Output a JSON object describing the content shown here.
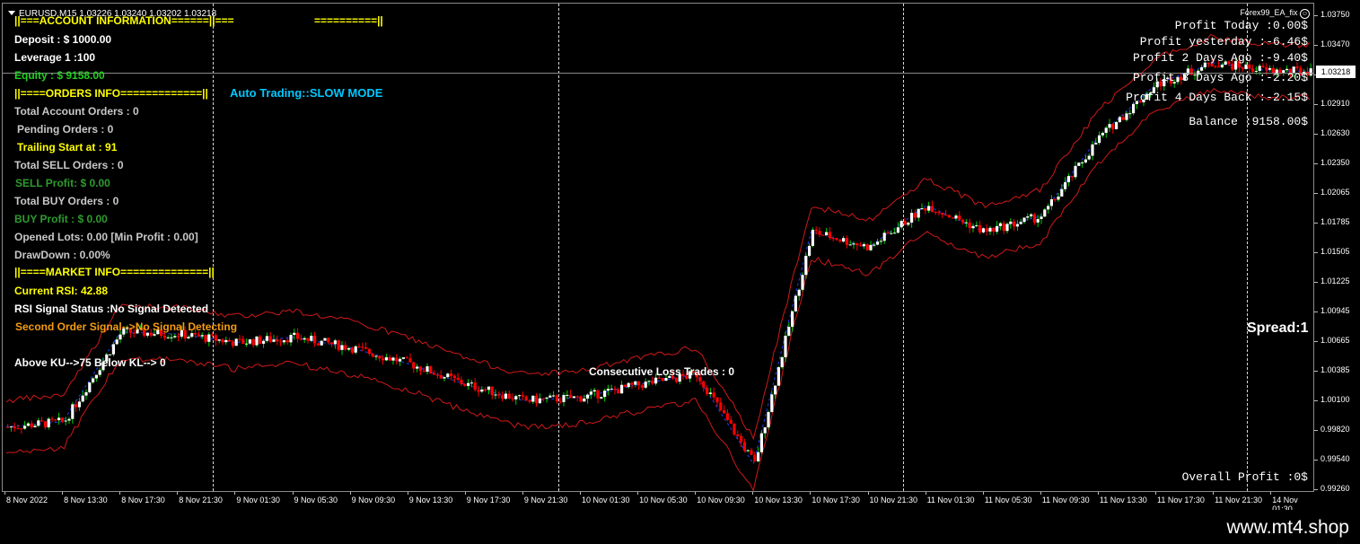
{
  "window": {
    "title": "EURUSD,M15  1.03226 1.03240 1.03202 1.03218",
    "ea_name": "Forex99_EA_fix",
    "smile_glyph": "☺"
  },
  "panel": {
    "account_header": "||===ACCOUNT INFORMATION======||===",
    "header_tail": "==========||",
    "deposit": "Deposit : $ 1000.00",
    "leverage": "Leverage 1 :100",
    "equity": "Equity : $ 9158.00",
    "orders_header": "||====ORDERS INFO=============||",
    "auto_trading": "Auto Trading::SLOW MODE",
    "total_account_orders": "Total Account Orders : 0",
    "pending_orders": "Pending Orders :  0",
    "trailing_start": "Trailing Start at :  91",
    "total_sell_orders": "Total SELL Orders :  0",
    "sell_profit": "SELL Profit: $ 0.00",
    "total_buy_orders": "Total BUY Orders :  0",
    "buy_profit": "BUY Profit : $ 0.00",
    "opened_lots": "Opened Lots: 0.00   [Min Profit :  0.00]",
    "drawdown": "DrawDown : 0.00%",
    "market_header": "||====MARKET INFO==============||",
    "current_rsi": "Current RSI:  42.88",
    "rsi_signal": "RSI Signal Status :No Signal  Detected",
    "second_order": "Second Order Signal-->No Signal Detecting",
    "above_below": "Above KU-->75 Below KL--> 0",
    "consecutive_loss": "Consecutive Loss Trades :  0",
    "spread": "Spread:1"
  },
  "profit_stats": {
    "today": "Profit Today :0.00$",
    "yesterday": "Profit yesterday :-6.46$",
    "two_days": "Profit 2 Days Ago :-9.40$",
    "three_days": "Profit 3 Days Ago :-2.20$",
    "four_days": "Profit 4 Days Back :-2.15$",
    "balance": "Balance :9158.00$",
    "overall": "Overall Profit :0$"
  },
  "price_axis": {
    "labels": [
      "1.03750",
      "1.03470",
      "1.03190",
      "1.02910",
      "1.02630",
      "1.02350",
      "1.02065",
      "1.01785",
      "1.01505",
      "1.01225",
      "1.00945",
      "1.00665",
      "1.00385",
      "1.00100",
      "0.99820",
      "0.99540",
      "0.99260"
    ],
    "current_price": "1.03218"
  },
  "time_axis": {
    "labels": [
      "8 Nov 2022",
      "8 Nov 13:30",
      "8 Nov 17:30",
      "8 Nov 21:30",
      "9 Nov 01:30",
      "9 Nov 05:30",
      "9 Nov 09:30",
      "9 Nov 13:30",
      "9 Nov 17:30",
      "9 Nov 21:30",
      "10 Nov 01:30",
      "10 Nov 05:30",
      "10 Nov 09:30",
      "10 Nov 13:30",
      "10 Nov 17:30",
      "10 Nov 21:30",
      "11 Nov 01:30",
      "11 Nov 05:30",
      "11 Nov 09:30",
      "11 Nov 13:30",
      "11 Nov 17:30",
      "11 Nov 21:30",
      "14 Nov 01:30"
    ]
  },
  "colors": {
    "bull": "#ffffff",
    "bear": "#ff0000",
    "wick_bull": "#00d000",
    "wick_bear": "#ff0000",
    "band": "#d01818",
    "mid": "#2040ff"
  },
  "chart_data": {
    "type": "line",
    "symbol": "EURUSD",
    "timeframe": "M15",
    "ylim": [
      0.9926,
      1.0375
    ],
    "x": [
      "8 Nov 2022",
      "8 Nov 13:30",
      "8 Nov 17:30",
      "8 Nov 21:30",
      "9 Nov 01:30",
      "9 Nov 05:30",
      "9 Nov 09:30",
      "9 Nov 13:30",
      "9 Nov 17:30",
      "9 Nov 21:30",
      "10 Nov 01:30",
      "10 Nov 05:30",
      "10 Nov 09:30",
      "10 Nov 13:30",
      "10 Nov 17:30",
      "10 Nov 21:30",
      "11 Nov 01:30",
      "11 Nov 05:30",
      "11 Nov 09:30",
      "11 Nov 13:30",
      "11 Nov 17:30",
      "11 Nov 21:30",
      "14 Nov 01:30"
    ],
    "series": [
      {
        "values": [
          0.9985,
          0.999,
          1.0075,
          1.0073,
          1.0065,
          1.007,
          1.006,
          1.0045,
          1.0025,
          1.001,
          1.0013,
          1.0025,
          1.0035,
          0.995,
          1.017,
          1.0155,
          1.0195,
          1.017,
          1.0185,
          1.026,
          1.031,
          1.033,
          1.0322
        ]
      }
    ],
    "last": 1.03218
  }
}
